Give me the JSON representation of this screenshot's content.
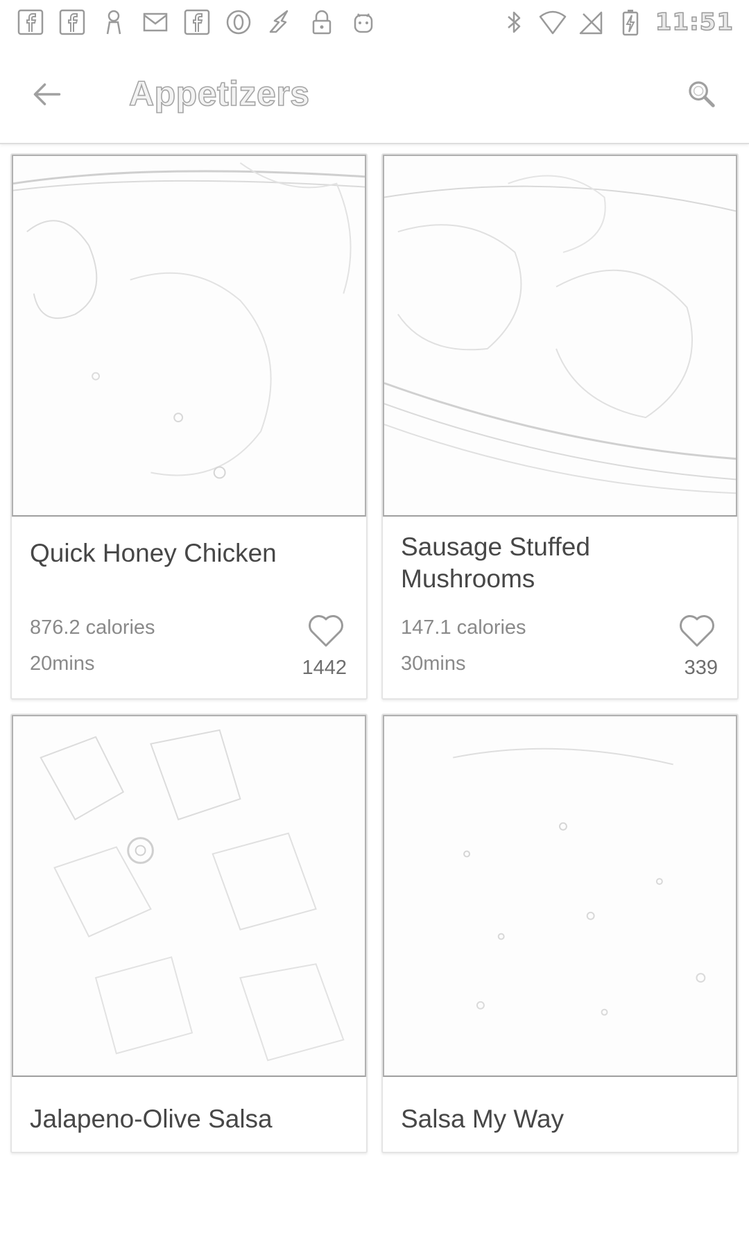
{
  "status_bar": {
    "left_icons": [
      "facebook-icon",
      "facebook-icon",
      "person-icon",
      "email-icon",
      "facebook-icon",
      "opera-icon",
      "fast-notification-icon",
      "lock-icon",
      "android-icon"
    ],
    "right_icons": [
      "bluetooth-icon",
      "wifi-icon",
      "no-sim-icon",
      "battery-charging-icon"
    ],
    "time": "11:51"
  },
  "toolbar": {
    "title": "Appetizers"
  },
  "recipes": [
    {
      "title": "Quick Honey Chicken",
      "calories": "876.2 calories",
      "time": "20mins",
      "likes": "1442"
    },
    {
      "title": "Sausage Stuffed Mushrooms",
      "calories": "147.1 calories",
      "time": "30mins",
      "likes": "339"
    },
    {
      "title": "Jalapeno-Olive Salsa"
    },
    {
      "title": "Salsa My Way"
    }
  ]
}
